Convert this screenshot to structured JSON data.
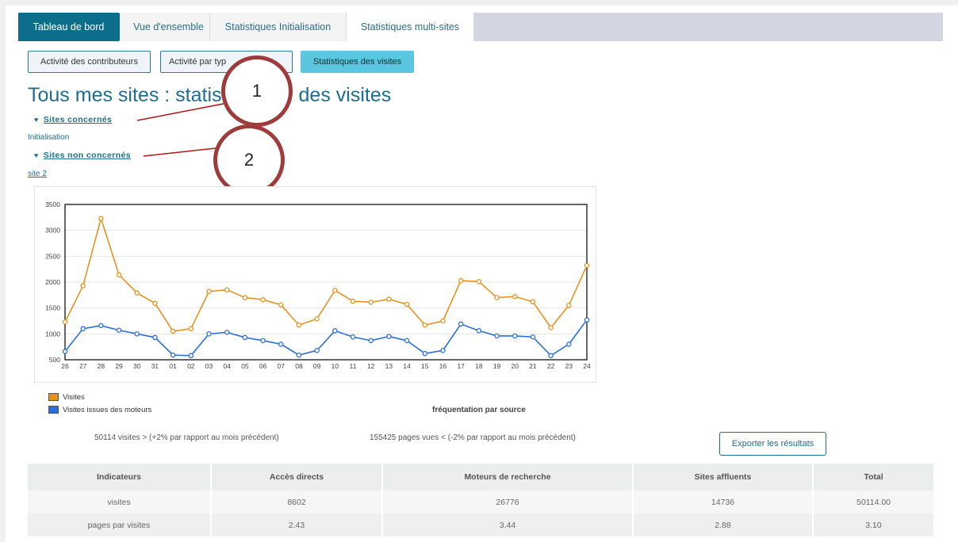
{
  "topnav": {
    "tabs": [
      {
        "label": "Tableau de bord"
      },
      {
        "label": "Vue d'ensemble"
      },
      {
        "label": "Statistiques Initialisation"
      },
      {
        "label": "Statistiques multi-sites"
      }
    ]
  },
  "subnav": {
    "buttons": [
      {
        "label": "Activité des contributeurs"
      },
      {
        "label": "Activité par typ"
      },
      {
        "label": "Statistiques des visites"
      }
    ]
  },
  "page_title": "Tous mes sites : statis",
  "page_title_tail": "des visites",
  "sites_concernes": {
    "label": "Sites concernés",
    "items": [
      "Initialisation"
    ]
  },
  "sites_non_concernes": {
    "label": "Sites non concernés",
    "items": [
      "site 2"
    ]
  },
  "callouts": [
    "1",
    "2"
  ],
  "chart_data": {
    "type": "line",
    "categories": [
      "26",
      "27",
      "28",
      "29",
      "30",
      "31",
      "01",
      "02",
      "03",
      "04",
      "05",
      "06",
      "07",
      "08",
      "09",
      "10",
      "11",
      "12",
      "13",
      "14",
      "15",
      "16",
      "17",
      "18",
      "19",
      "20",
      "21",
      "22",
      "23",
      "24"
    ],
    "ylim": [
      500,
      3500
    ],
    "yticks": [
      500,
      1000,
      1500,
      2000,
      2500,
      3000,
      3500
    ],
    "grid": true,
    "legend_position": "bottom-left",
    "series": [
      {
        "name": "Visites",
        "color": "#e8921e",
        "values": [
          1230,
          1930,
          3230,
          2140,
          1790,
          1590,
          1050,
          1100,
          1820,
          1850,
          1700,
          1660,
          1560,
          1170,
          1290,
          1840,
          1630,
          1610,
          1670,
          1570,
          1170,
          1250,
          2030,
          2010,
          1700,
          1720,
          1620,
          1120,
          1550,
          2320
        ]
      },
      {
        "name": "Visites issues des moteurs",
        "color": "#2b6fd8",
        "values": [
          660,
          1100,
          1160,
          1070,
          1000,
          930,
          590,
          580,
          1000,
          1030,
          930,
          870,
          800,
          590,
          680,
          1060,
          940,
          870,
          950,
          870,
          620,
          680,
          1190,
          1060,
          960,
          960,
          940,
          580,
          800,
          1270
        ]
      }
    ]
  },
  "source_title": "fréquentation par source",
  "summary": {
    "visits": "50114 visites > (+2% par rapport au mois précédent)",
    "pages": "155425 pages vues < (-2% par rapport au mois précédent)"
  },
  "export_label": "Exporter les résultats",
  "table": {
    "headers": [
      "Indicateurs",
      "Accès directs",
      "Moteurs de recherche",
      "Sites affluents",
      "Total"
    ],
    "rows": [
      [
        "visites",
        "8602",
        "26776",
        "14736",
        "50114.00"
      ],
      [
        "pages par visites",
        "2.43",
        "3.44",
        "2.88",
        "3.10"
      ]
    ]
  }
}
